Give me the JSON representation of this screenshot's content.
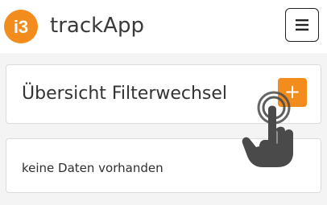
{
  "header": {
    "logo_text": "i3",
    "app_name": "trackApp",
    "menu_icon": "hamburger-menu-icon"
  },
  "overview": {
    "title": "Übersicht Filterwechsel",
    "add_label": "+"
  },
  "empty_state": {
    "message": "keine Daten vorhanden"
  },
  "gesture": {
    "icon": "tap-hand-icon"
  },
  "colors": {
    "brand": "#f28c1c",
    "background": "#f4f4f4",
    "text": "#333333",
    "hand": "#4a4a4a"
  }
}
